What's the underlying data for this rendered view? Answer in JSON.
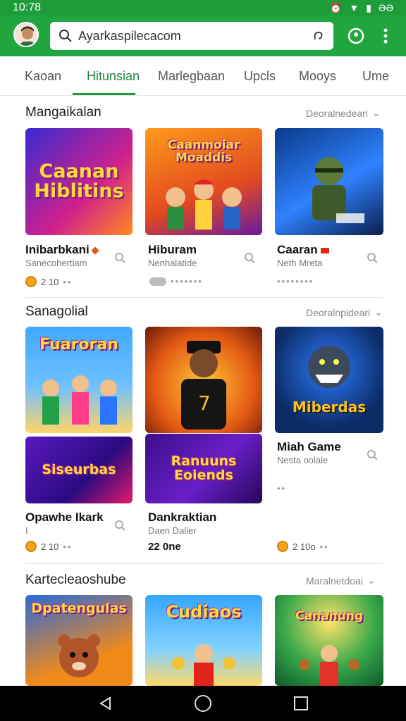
{
  "status": {
    "time": "10:78",
    "right": "ƏƏ"
  },
  "search": {
    "url": "Ayarkaspilecacom"
  },
  "tabs": [
    "Kaoan",
    "Hitunsian",
    "Marlegbaan",
    "Upcls",
    "Mooys",
    "Ume"
  ],
  "sections": [
    {
      "title": "Mangaikalan",
      "more": "Deoralnedeari"
    },
    {
      "title": "Sanagolial",
      "more": "Deoralnpideari"
    },
    {
      "title": "Kartecleaoshube",
      "more": "Maralnetdoai"
    }
  ],
  "row1": [
    {
      "art": "Caanan Hiblitins",
      "name": "Inibarbkani",
      "sub": "Sanecohertiam",
      "meta": "2 10"
    },
    {
      "art": "Caanmoiar Moaddis",
      "name": "Hiburam",
      "sub": "Nenhalatide",
      "meta": ""
    },
    {
      "art": "",
      "name": "Caaran",
      "sub": "Neth Mreta",
      "meta": ""
    }
  ],
  "row2": [
    {
      "art": "Fuaroran",
      "name": "",
      "sub": "",
      "meta": ""
    },
    {
      "art": "",
      "name": "",
      "sub": "",
      "meta": ""
    },
    {
      "art": "Miberdas",
      "name": "Miah Game",
      "sub": "Nesta oolale",
      "meta": ""
    }
  ],
  "row3": [
    {
      "art": "Siseurbas",
      "name": "Opawhe Ikark",
      "sub": "",
      "meta": "2 10"
    },
    {
      "art": "Ranuuns Eoiends",
      "name": "Dankraktian",
      "sub": "Daen Dalier",
      "meta": "22 0ne"
    },
    {
      "art": "",
      "name": "",
      "sub": "",
      "meta": "2 10o"
    }
  ],
  "row4": [
    {
      "art": "Dpatengulas"
    },
    {
      "art": "Cudiaos"
    },
    {
      "art": "Cananung"
    }
  ],
  "colors": {
    "brand": "#20a53f",
    "accent": "#1d8a3a"
  }
}
